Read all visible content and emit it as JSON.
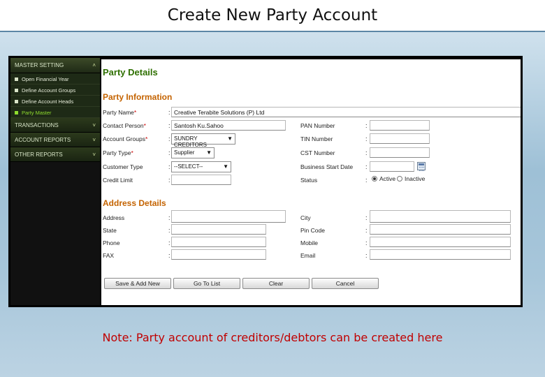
{
  "slide": {
    "title": "Create New Party Account",
    "note": "Note: Party account of creditors/debtors can be created here"
  },
  "sidebar": {
    "master_setting": "MASTER SETTING",
    "items": [
      {
        "label": "Open Financial Year"
      },
      {
        "label": "Define Account Groups"
      },
      {
        "label": "Define Account Heads"
      },
      {
        "label": "Party Master",
        "active": true
      }
    ],
    "transactions": "TRANSACTIONS",
    "account_reports": "ACCOUNT REPORTS",
    "other_reports": "OTHER REPORTS",
    "chevron_up": "˄",
    "chevron_down": "˅"
  },
  "page": {
    "title": "Party Details",
    "info_section": "Party Information",
    "address_section": "Address Details"
  },
  "fields": {
    "party_name": {
      "label": "Party Name",
      "req": "*",
      "value": "Creative Terabite Solutions (P) Ltd"
    },
    "contact_person": {
      "label": "Contact Person",
      "req": "*",
      "value": "Santosh Ku.Sahoo"
    },
    "account_groups": {
      "label": "Account Groups",
      "req": "*",
      "value": "SUNDRY CREDITORS"
    },
    "party_type": {
      "label": "Party Type",
      "req": "*",
      "value": "Supplier"
    },
    "customer_type": {
      "label": "Customer Type",
      "value": "--SELECT--"
    },
    "credit_limit": {
      "label": "Credit Limit",
      "value": ""
    },
    "pan_number": {
      "label": "PAN Number",
      "value": ""
    },
    "tin_number": {
      "label": "TIN Number",
      "value": ""
    },
    "cst_number": {
      "label": "CST Number",
      "value": ""
    },
    "business_start_date": {
      "label": "Business Start Date",
      "value": ""
    },
    "status": {
      "label": "Status",
      "active": "Active",
      "inactive": "Inactive",
      "selected": "Active"
    },
    "address": {
      "label": "Address",
      "value": ""
    },
    "state": {
      "label": "State",
      "value": ""
    },
    "phone": {
      "label": "Phone",
      "value": ""
    },
    "fax": {
      "label": "FAX",
      "value": ""
    },
    "city": {
      "label": "City",
      "value": ""
    },
    "pincode": {
      "label": "Pin Code",
      "value": ""
    },
    "mobile": {
      "label": "Mobile",
      "value": ""
    },
    "email": {
      "label": "Email",
      "value": ""
    }
  },
  "buttons": {
    "save_add": "Save & Add New",
    "go_to_list": "Go To List",
    "clear": "Clear",
    "cancel": "Cancel"
  },
  "colon": ":",
  "dropdown_arrow": "▼"
}
